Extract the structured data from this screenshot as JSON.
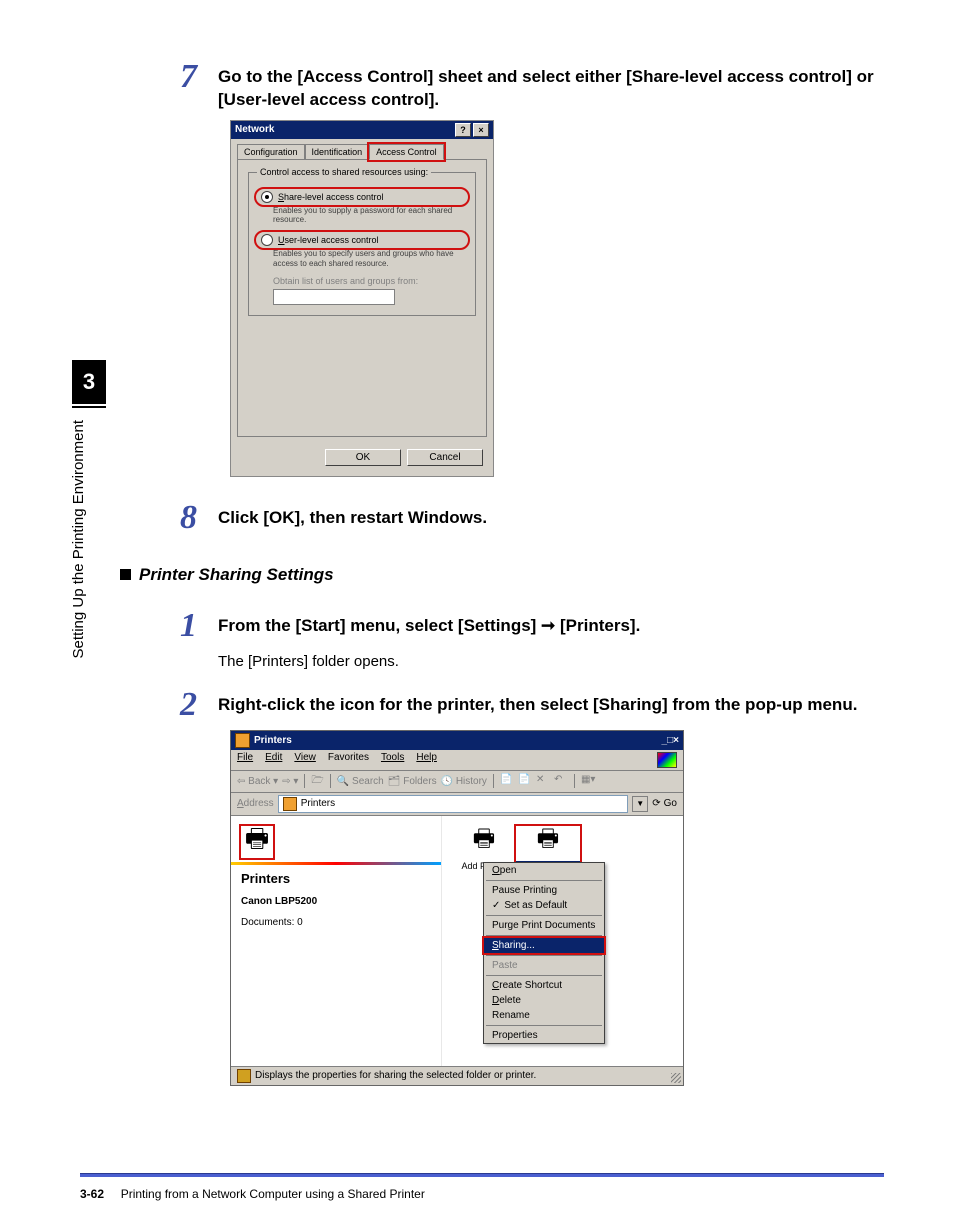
{
  "side": {
    "chapter": "3",
    "label": "Setting Up the Printing Environment"
  },
  "step7": {
    "num": "7",
    "title": "Go to the [Access Control] sheet and select either [Share-level access control] or [User-level access control]."
  },
  "network_dialog": {
    "title": "Network",
    "help_btn": "?",
    "close_btn": "×",
    "tabs": {
      "config": "Configuration",
      "ident": "Identification",
      "access": "Access Control"
    },
    "group_legend": "Control access to shared resources using:",
    "radio1_label": "Share-level access control",
    "radio1_desc": "Enables you to supply a password for each shared resource.",
    "radio2_label": "User-level access control",
    "radio2_desc": "Enables you to specify users and groups who have access to each shared resource.",
    "obtain_label": "Obtain list of users and groups from:",
    "ok": "OK",
    "cancel": "Cancel"
  },
  "step8": {
    "num": "8",
    "title": "Click [OK], then restart Windows."
  },
  "section": {
    "heading": "Printer Sharing Settings"
  },
  "step1": {
    "num": "1",
    "title": "From the [Start] menu, select [Settings] ➞ [Printers].",
    "body": "The [Printers] folder opens."
  },
  "step2": {
    "num": "2",
    "title": "Right-click the icon for the printer, then select [Sharing] from the pop-up menu."
  },
  "printers_win": {
    "title": "Printers",
    "menus": {
      "file": "File",
      "edit": "Edit",
      "view": "View",
      "favorites": "Favorites",
      "tools": "Tools",
      "help": "Help"
    },
    "toolbar": {
      "back": "Back",
      "search": "Search",
      "folders": "Folders",
      "history": "History"
    },
    "address_label": "Address",
    "address_value": "Printers",
    "go": "Go",
    "left": {
      "title": "Printers",
      "selected": "Canon LBP5200",
      "docs": "Documents: 0"
    },
    "icons": {
      "add_printer": "Add Printer",
      "canon": "Canon LBP5200"
    },
    "context": {
      "open": "Open",
      "pause": "Pause Printing",
      "setdefault": "Set as Default",
      "purge": "Purge Print Documents",
      "sharing": "Sharing...",
      "paste": "Paste",
      "shortcut": "Create Shortcut",
      "delete": "Delete",
      "rename": "Rename",
      "properties": "Properties"
    },
    "status": "Displays the properties for sharing the selected folder or printer."
  },
  "footer": {
    "page": "3-62",
    "text": "Printing from a Network Computer using a Shared Printer"
  }
}
